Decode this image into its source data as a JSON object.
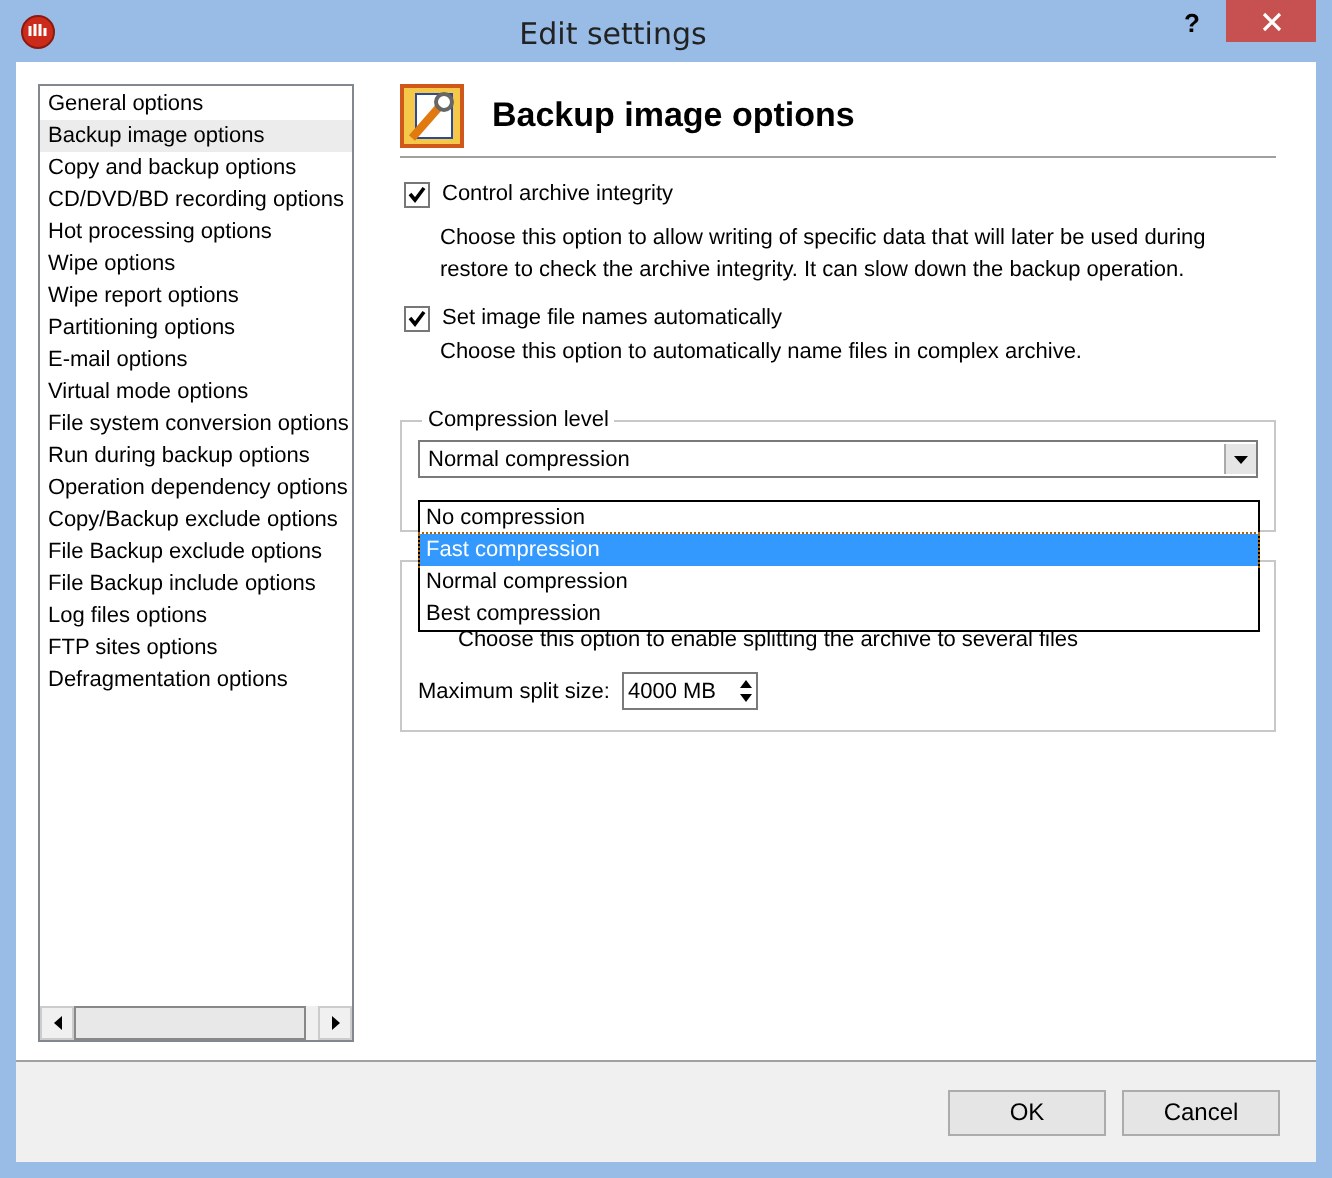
{
  "window": {
    "title": "Edit settings",
    "help": "?"
  },
  "sidebar": {
    "items": [
      {
        "label": "General options",
        "selected": false
      },
      {
        "label": "Backup image options",
        "selected": true
      },
      {
        "label": "Copy and backup options",
        "selected": false
      },
      {
        "label": "CD/DVD/BD recording options",
        "selected": false
      },
      {
        "label": "Hot processing options",
        "selected": false
      },
      {
        "label": "Wipe options",
        "selected": false
      },
      {
        "label": "Wipe report options",
        "selected": false
      },
      {
        "label": "Partitioning options",
        "selected": false
      },
      {
        "label": "E-mail options",
        "selected": false
      },
      {
        "label": "Virtual mode options",
        "selected": false
      },
      {
        "label": "File system conversion options",
        "selected": false
      },
      {
        "label": "Run during backup options",
        "selected": false
      },
      {
        "label": "Operation dependency options",
        "selected": false
      },
      {
        "label": "Copy/Backup exclude options",
        "selected": false
      },
      {
        "label": "File Backup exclude options",
        "selected": false
      },
      {
        "label": "File Backup include options",
        "selected": false
      },
      {
        "label": "Log files options",
        "selected": false
      },
      {
        "label": "FTP sites options",
        "selected": false
      },
      {
        "label": "Defragmentation options",
        "selected": false
      }
    ]
  },
  "page": {
    "title": "Backup image options"
  },
  "options": [
    {
      "label": "Control archive integrity",
      "checked": true,
      "description": "Choose this option to allow writing of specific data that will later be used during restore to check the archive integrity. It can slow down the backup operation."
    },
    {
      "label": "Set image file names automatically",
      "checked": true,
      "description": "Choose this option to automatically name files in complex archive."
    }
  ],
  "compression": {
    "legend": "Compression level",
    "value": "Normal compression",
    "open": true,
    "items": [
      {
        "label": "No compression",
        "highlighted": false
      },
      {
        "label": "Fast compression",
        "highlighted": true
      },
      {
        "label": "Normal compression",
        "highlighted": false
      },
      {
        "label": "Best compression",
        "highlighted": false
      }
    ]
  },
  "splitting": {
    "description": "Choose this option to enable splitting the archive to several files",
    "size_label": "Maximum split size:",
    "size_value": "4000 MB"
  },
  "buttons": [
    "OK",
    "Cancel"
  ]
}
